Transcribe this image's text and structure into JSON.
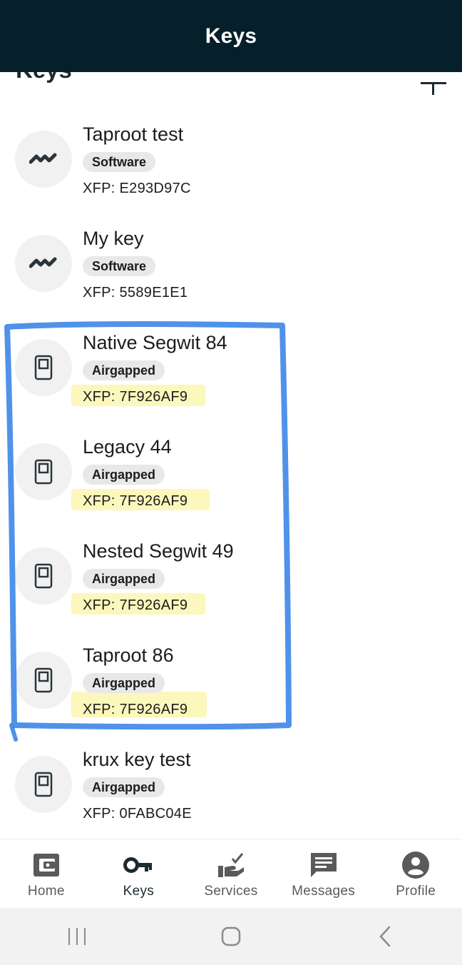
{
  "header": {
    "title": "Keys"
  },
  "section": {
    "title": "Keys",
    "add_icon": "plus-icon"
  },
  "keys": [
    {
      "name": "Taproot test",
      "badge": "Software",
      "xfp": "XFP: E293D97C",
      "icon": "software-key-icon",
      "highlighted": false
    },
    {
      "name": "My key",
      "badge": "Software",
      "xfp": "XFP: 5589E1E1",
      "icon": "software-key-icon",
      "highlighted": false
    },
    {
      "name": "Native Segwit 84",
      "badge": "Airgapped",
      "xfp": "XFP: 7F926AF9",
      "icon": "airgapped-device-icon",
      "highlighted": true
    },
    {
      "name": "Legacy 44",
      "badge": "Airgapped",
      "xfp": "XFP: 7F926AF9",
      "icon": "airgapped-device-icon",
      "highlighted": true
    },
    {
      "name": "Nested Segwit 49",
      "badge": "Airgapped",
      "xfp": "XFP: 7F926AF9",
      "icon": "airgapped-device-icon",
      "highlighted": true
    },
    {
      "name": "Taproot 86",
      "badge": "Airgapped",
      "xfp": "XFP: 7F926AF9",
      "icon": "airgapped-device-icon",
      "highlighted": true
    },
    {
      "name": "krux key test",
      "badge": "Airgapped",
      "xfp": "XFP: 0FABC04E",
      "icon": "airgapped-device-icon",
      "highlighted": false
    }
  ],
  "tabs": [
    {
      "label": "Home",
      "icon": "wallet-icon",
      "active": false
    },
    {
      "label": "Keys",
      "icon": "key-icon",
      "active": true
    },
    {
      "label": "Services",
      "icon": "services-icon",
      "active": false
    },
    {
      "label": "Messages",
      "icon": "messages-icon",
      "active": false
    },
    {
      "label": "Profile",
      "icon": "profile-icon",
      "active": false
    }
  ],
  "system_nav": [
    "recent-apps-icon",
    "home-circle-icon",
    "back-icon"
  ],
  "colors": {
    "header_bg": "#06202b",
    "annotation_blue": "#3d86e8",
    "highlight_yellow": "#fbf6b0",
    "badge_bg": "#e8e8e8"
  }
}
